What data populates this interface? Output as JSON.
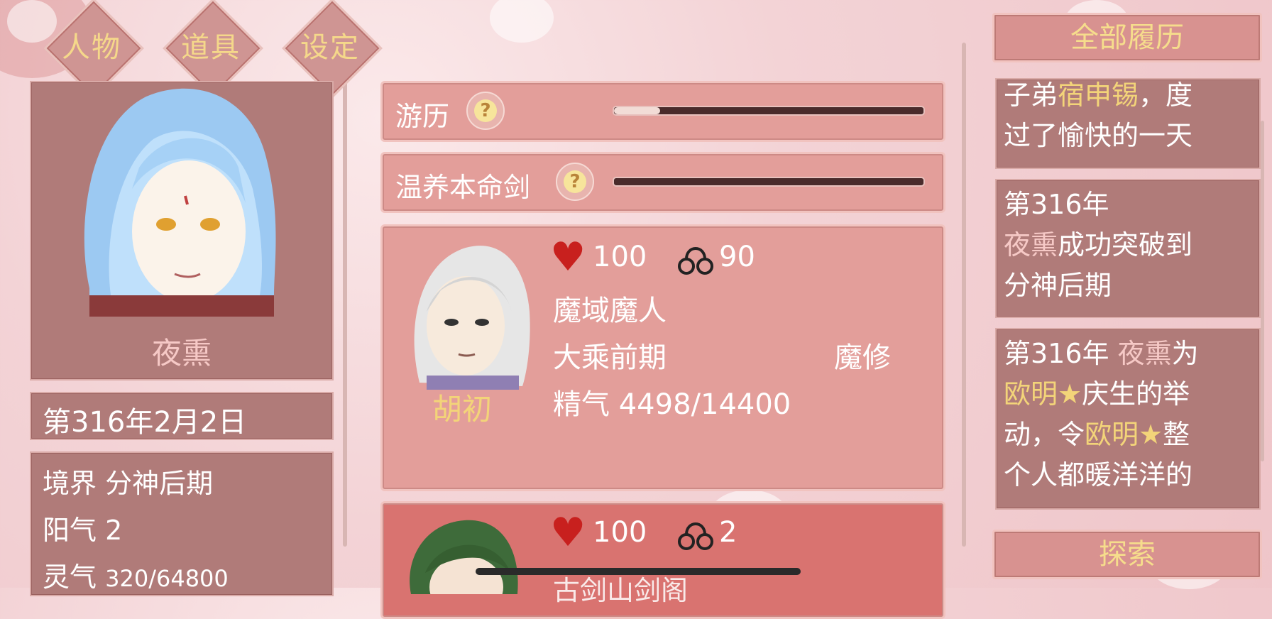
{
  "colors": {
    "gold": "#f3d479",
    "pink_name": "#f6c9c6",
    "panel": "#b07b79",
    "card": "#e39e9a",
    "heart": "#c8201e"
  },
  "top_tabs": {
    "characters": "人物",
    "items": "道具",
    "settings": "设定"
  },
  "player": {
    "name": "夜熏",
    "date": "第316年2月2日",
    "realm_label": "境界",
    "realm_value": "分神后期",
    "yang_label": "阳气",
    "yang_value": "2",
    "spirit_label": "灵气",
    "spirit_value": "320/64800"
  },
  "activities": [
    {
      "label": "游历",
      "progress": 0.15,
      "icon": "question-icon"
    },
    {
      "label": "温养本命剑",
      "progress": 0.0,
      "icon": "question-icon"
    }
  ],
  "npc_cards": [
    {
      "name": "胡初",
      "hp": "100",
      "bond": "90",
      "origin": "魔域魔人",
      "stage": "大乘前期",
      "path": "魔修",
      "essence_label": "精气",
      "essence_value": "4498/14400"
    },
    {
      "name": "",
      "hp": "100",
      "bond": "2",
      "origin": "古剑山剑阁"
    }
  ],
  "history": {
    "title": "全部履历",
    "explore": "探索",
    "entries": {
      "e0_line1_a": "子弟",
      "e0_line1_name": "宿申锡",
      "e0_line1_b": "，度",
      "e0_line2": "过了愉快的一天",
      "e1_line1": "第316年",
      "e1_line2_name": "夜熏",
      "e1_line2_b": "成功突破到",
      "e1_line3": "分神后期",
      "e2_line1_a": "第316年 ",
      "e2_line1_name": "夜熏",
      "e2_line1_b": "为",
      "e2_line2_name": "欧明★",
      "e2_line2_b": "庆生的举",
      "e2_line3_a": "动，令",
      "e2_line3_name": "欧明★",
      "e2_line3_b": "整",
      "e2_line4": "个人都暖洋洋的"
    }
  }
}
